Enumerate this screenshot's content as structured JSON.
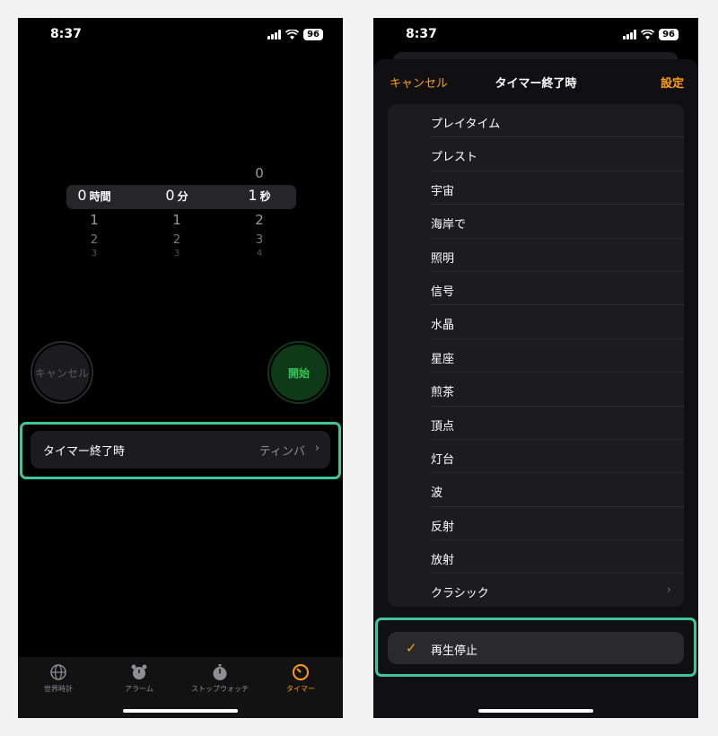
{
  "left": {
    "status": {
      "time": "8:37",
      "battery": "96"
    },
    "picker": {
      "hours": {
        "selected": "0",
        "unit": "時間",
        "next": [
          "1",
          "2",
          "3"
        ]
      },
      "minutes": {
        "selected": "0",
        "unit": "分",
        "next": [
          "1",
          "2",
          "3"
        ]
      },
      "seconds": {
        "above": "0",
        "selected": "1",
        "unit": "秒",
        "next": [
          "2",
          "3",
          "4"
        ]
      }
    },
    "cancel_label": "キャンセル",
    "start_label": "開始",
    "timer_ends": {
      "label": "タイマー終了時",
      "value": "ティンバ"
    },
    "tabs": [
      {
        "label": "世界時計",
        "icon": "globe-icon"
      },
      {
        "label": "アラーム",
        "icon": "alarm-clock-icon"
      },
      {
        "label": "ストップウォッチ",
        "icon": "stopwatch-icon"
      },
      {
        "label": "タイマー",
        "icon": "timer-icon",
        "active": true
      }
    ]
  },
  "right": {
    "status": {
      "time": "8:37",
      "battery": "96"
    },
    "nav": {
      "cancel": "キャンセル",
      "title": "タイマー終了時",
      "set": "設定"
    },
    "sounds": [
      "プレイタイム",
      "プレスト",
      "宇宙",
      "海岸で",
      "照明",
      "信号",
      "水晶",
      "星座",
      "煎茶",
      "頂点",
      "灯台",
      "波",
      "反射",
      "放射"
    ],
    "classic_label": "クラシック",
    "stop_playing": {
      "label": "再生停止",
      "checked": true
    }
  },
  "colors": {
    "accent": "#ff9f0a",
    "start_green": "#35c759",
    "highlight": "#3ec69a"
  }
}
